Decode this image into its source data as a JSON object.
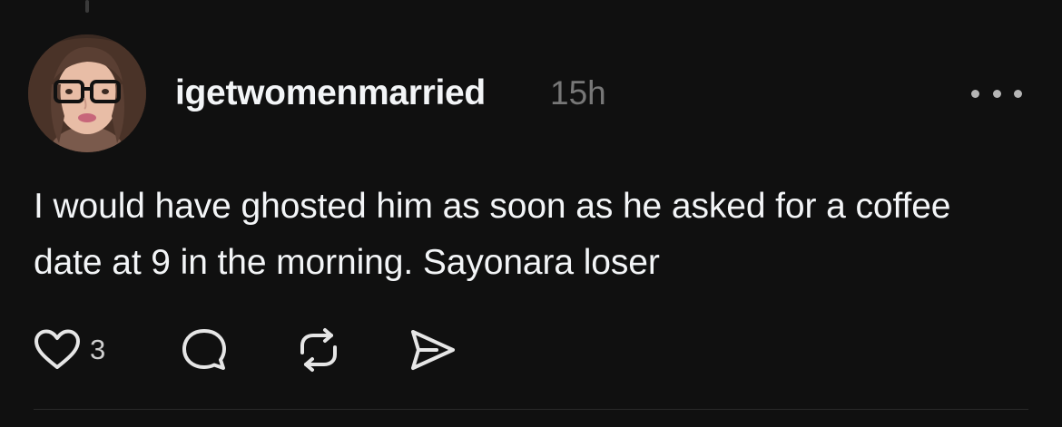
{
  "post": {
    "username": "igetwomenmarried",
    "time": "15h",
    "text": "I would have ghosted him as soon as he asked for a coffee date at 9 in the morning. Sayonara loser",
    "likes": "3"
  },
  "icons": {
    "more": "more-horizontal-icon",
    "like": "heart-icon",
    "reply": "comment-bubble-icon",
    "repost": "repost-icon",
    "share": "send-icon"
  },
  "colors": {
    "background": "#101010",
    "text": "#f3f5f7",
    "muted": "#777777"
  }
}
